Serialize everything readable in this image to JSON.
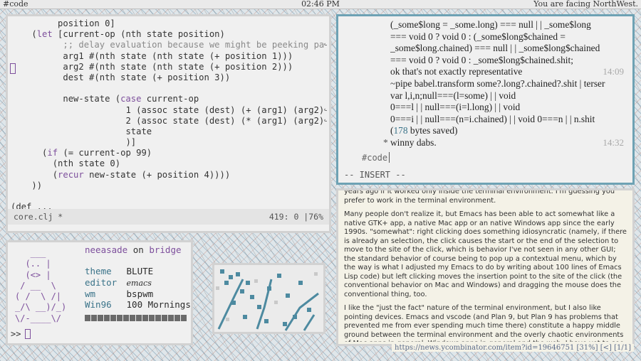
{
  "topbar": {
    "left": "#code",
    "clock": "02:46 PM",
    "right": "You are facing NorthWest."
  },
  "editor": {
    "lines": [
      {
        "indent": "         ",
        "parts": [
          {
            "t": "position 0]"
          }
        ]
      },
      {
        "indent": "    ",
        "parts": [
          {
            "t": "(",
            "c": ""
          },
          {
            "t": "let",
            "c": "kw"
          },
          {
            "t": " [current-op (nth state position)"
          }
        ]
      },
      {
        "indent": "          ",
        "parts": [
          {
            "t": ";; delay evaluation because we might be peeking pa",
            "c": "cm"
          }
        ],
        "wrap": true
      },
      {
        "indent": "          ",
        "parts": [
          {
            "t": "arg1 #(nth state (nth state (+ position 1)))"
          }
        ]
      },
      {
        "indent": "          ",
        "parts": [
          {
            "t": "arg2 #(nth state (nth state (+ position 2)))"
          }
        ]
      },
      {
        "indent": "          ",
        "parts": [
          {
            "t": "dest #(nth state (+ position 3))"
          }
        ]
      },
      {
        "indent": "",
        "parts": [
          {
            "t": ""
          }
        ]
      },
      {
        "indent": "          ",
        "parts": [
          {
            "t": "new-state ("
          },
          {
            "t": "case",
            "c": "kw"
          },
          {
            "t": " current-op"
          }
        ]
      },
      {
        "indent": "                      ",
        "parts": [
          {
            "t": "1 (assoc state (dest) (+ (arg1) (arg2)"
          }
        ],
        "wrap": true
      },
      {
        "indent": "                      ",
        "parts": [
          {
            "t": "2 (assoc state (dest) (* (arg1) (arg2)"
          }
        ],
        "wrap": true
      },
      {
        "indent": "                      ",
        "parts": [
          {
            "t": "state"
          }
        ]
      },
      {
        "indent": "                      ",
        "parts": [
          {
            "t": ")]"
          }
        ]
      },
      {
        "indent": "      ",
        "parts": [
          {
            "t": "("
          },
          {
            "t": "if",
            "c": "kw"
          },
          {
            "t": " (= current-op 99)"
          }
        ]
      },
      {
        "indent": "        ",
        "parts": [
          {
            "t": "(nth state 0)"
          }
        ]
      },
      {
        "indent": "        ",
        "parts": [
          {
            "t": "("
          },
          {
            "t": "recur",
            "c": "kw"
          },
          {
            "t": " new-state (+ position 4))))"
          }
        ]
      },
      {
        "indent": "    ",
        "parts": [
          {
            "t": "))"
          }
        ]
      },
      {
        "indent": "",
        "parts": [
          {
            "t": ""
          }
        ]
      },
      {
        "indent": "",
        "parts": [
          {
            "t": "(def ..."
          }
        ]
      }
    ],
    "modeline": {
      "file": "core.clj *",
      "position": "419: 0 |76%"
    }
  },
  "irc": {
    "lines": [
      {
        "text": "(_some$long = _some.long) === null | | _some$long"
      },
      {
        "text": "=== void 0 ? void 0 : (_some$long$chained ="
      },
      {
        "text": "_some$long.chained) === null | | _some$long$chained"
      },
      {
        "text": "=== void 0 ? void 0 : _some$long$chained.shit;"
      },
      {
        "text": "ok that's not exactly representative",
        "ts": "14:09"
      },
      {
        "text": "~pipe babel.transform some?.long?.chained?.shit | terser"
      },
      {
        "text": "var l,i,n;null===(l=some) | | void"
      },
      {
        "text": "0===l | | null===(i=l.long) | | void"
      },
      {
        "text": "0===i | | null===(n=i.chained) | | void 0===n | | n.shit"
      },
      {
        "text": "(178 bytes saved)",
        "hl": "178"
      },
      {
        "text": "winny dabs.",
        "ts": "14:32",
        "star": "*"
      }
    ],
    "prompt": "#code",
    "mode": "-- INSERT --"
  },
  "fetch": {
    "ascii": "   ___\n  (.. |\n  (<> |\n / __  \\\n( /  \\ /|\n_/\\ __)/_)\n\\/-____\\/",
    "user": "neeasade",
    "on": "on",
    "host": "bridge",
    "fields": [
      {
        "k": "theme",
        "v": "BLUTE"
      },
      {
        "k": "editor",
        "v": "emacs"
      },
      {
        "k": "wm",
        "v": "bspwm"
      },
      {
        "k": "Win96",
        "v": "100 Mornings"
      }
    ],
    "prompt": ">>"
  },
  "browser": {
    "paragraphs": [
      "years ago if it worked only inside the terminal environment. I'm guessing you prefer to work in the terminal environment.",
      "Many people don't realize it, but Emacs has been able to act somewhat like a native GTK+ app, a native Mac app or an native Windows app since the early 1990s. \"somewhat\": right clicking does something idiosyncratic (namely, if there is already an selection, the click causes the start or the end of the selection to move to the site of the click, which is behavior I've not seen in any other GUI; the standard behavior of course being to pop up a contextual menu, which by the way is what I adjusted my Emacs to do by writing about 100 lines of Emacs Lisp code) but left clicking moves the insertion point to the site of the click (the conventional behavior on Mac and Windows) and dragging the mouse does the conventional thing, too.",
      "I like the \"just the fact\" nature of the terminal environment, but I also like pointing devices. Emacs and vscode (and Plan 9, but Plan 9 has problems that prevented me from ever spending much time there) constitute a happy middle ground between the terminal environment and the overly chaotic environments of Mac apps in general, Windows apps in general and the web. I have yet to see vscode's being used intensively (like Emacs is being used) for tasks other than programming, but would be delighted if vscode or maybe some platform"
    ],
    "status": "https://news.ycombinator.com/item?id=19646751 [31%] [<] [1/1]"
  },
  "colors": {
    "accent": "#6ea2b4",
    "keyword": "#7d4f9c",
    "highlight": "#3a7389"
  }
}
